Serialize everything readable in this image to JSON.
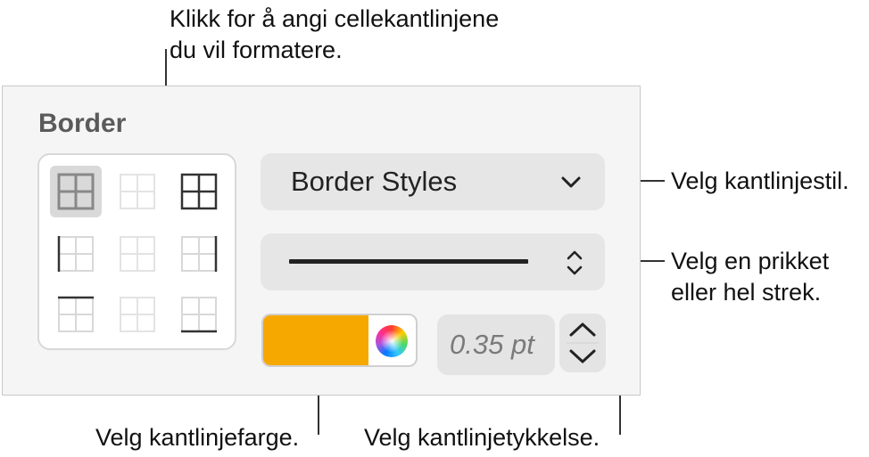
{
  "panel": {
    "section_title": "Border",
    "border_styles_label": "Border Styles",
    "thickness_value": "0.35 pt",
    "color_swatch": "#f7a800"
  },
  "callouts": {
    "cells": "Klikk for å angi cellekantlinjene\ndu vil formatere.",
    "style": "Velg kantlinjestil.",
    "line": "Velg en prikket\neller hel strek.",
    "color": "Velg kantlinjefarge.",
    "thickness": "Velg kantlinjetykkelse."
  },
  "icons": {
    "border_buttons": [
      "all-borders-icon",
      "inside-borders-icon",
      "outside-borders-icon",
      "left-border-icon",
      "inside-vertical-borders-icon",
      "right-border-icon",
      "top-border-icon",
      "inside-horizontal-borders-icon",
      "bottom-border-icon"
    ],
    "dropdown": "chevron-down-icon",
    "line_popup": "up-down-chevron-icon",
    "stepper": "stepper-arrows-icon"
  }
}
